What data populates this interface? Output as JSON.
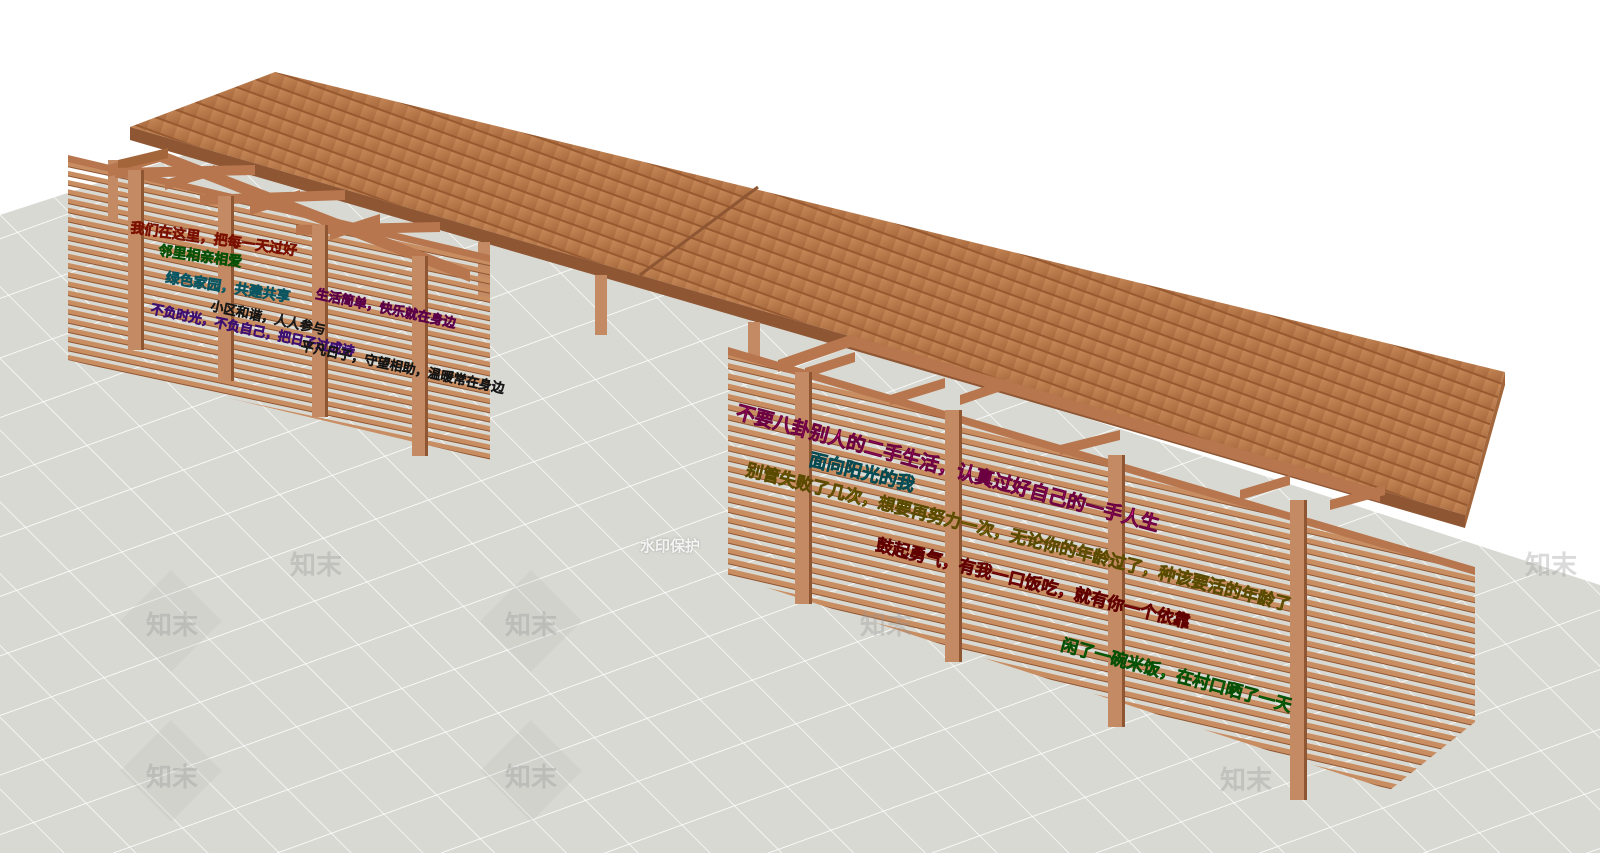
{
  "colors": {
    "background": "#ffffff",
    "floor": "#d7d7d1",
    "floor_grid": "#ffffff",
    "roof": "#b97a4a",
    "roof_slat": "#9c5f33",
    "beam": "#b7764e",
    "column": "#c48a64",
    "column_shadow": "#8e5633",
    "slat": "#c98d62"
  },
  "left_wall": {
    "slogans": [
      {
        "text": "我们在这里，把每一天过好",
        "color": "#ff3b1f"
      },
      {
        "text": "邻里相亲相爱",
        "color": "#13b813"
      },
      {
        "text": "绿色家园，共建共享",
        "color": "#1ecde0"
      },
      {
        "text": "生活简单，快乐就在身边",
        "color": "#c21fa3"
      },
      {
        "text": "小区和谐，人人参与",
        "color": "#3a3a3a"
      },
      {
        "text": "不负时光，不负自己，把日子过成诗",
        "color": "#9a3df2"
      },
      {
        "text": "平凡日子，守望相助，温暖常在身边",
        "color": "#3a3a3a"
      }
    ]
  },
  "right_wall": {
    "slogans": [
      {
        "text": "不要八卦别人的二手生活，认真过好自己的一手人生",
        "color": "#ff2aa6"
      },
      {
        "text": "面向阳光的我",
        "color": "#19c7dc"
      },
      {
        "text": "别管失败了几次，想要再努力一次，无论你的年龄过了，种该要活的年龄了",
        "color": "#e6c400"
      },
      {
        "text": "鼓起勇气，有我一口饭吃，就有你一个依靠",
        "color": "#ff2020"
      },
      {
        "text": "闲了一碗米饭，在村口晒了一天",
        "color": "#1ed21e"
      }
    ]
  },
  "watermark": {
    "brand": "知末",
    "protect_text": "水印保护"
  }
}
